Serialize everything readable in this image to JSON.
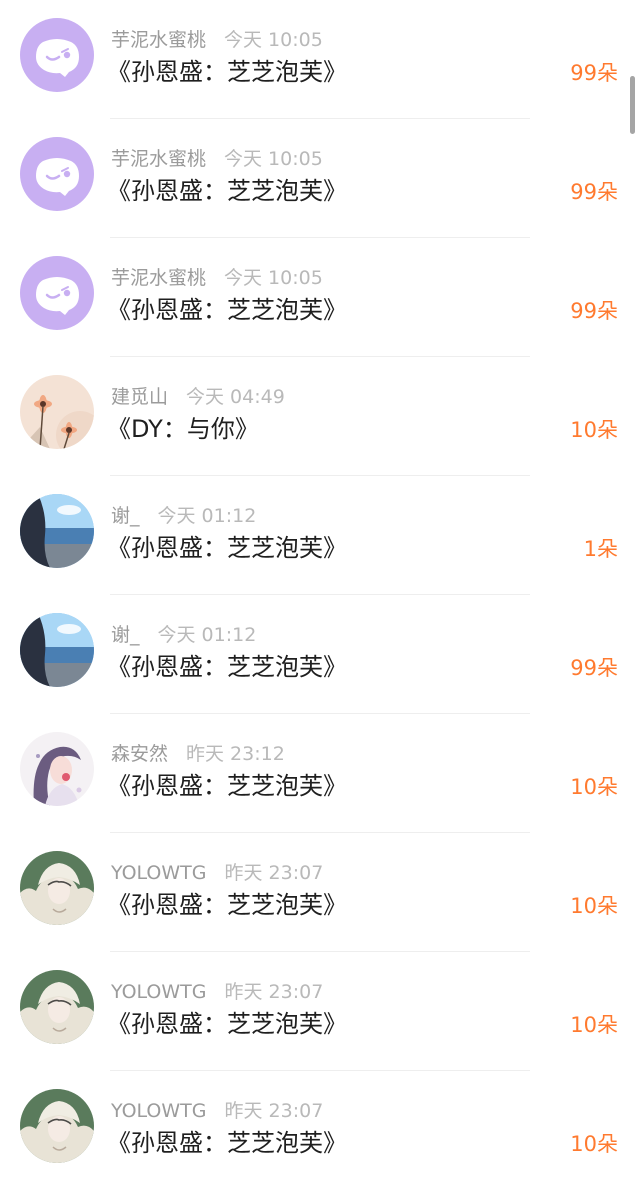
{
  "gift_list": {
    "items": [
      {
        "username": "芋泥水蜜桃",
        "time": "今天 10:05",
        "title": "《孙恩盛：芝芝泡芙》",
        "gift_count": "99朵",
        "avatar": "chat-bubble-avatar"
      },
      {
        "username": "芋泥水蜜桃",
        "time": "今天 10:05",
        "title": "《孙恩盛：芝芝泡芙》",
        "gift_count": "99朵",
        "avatar": "chat-bubble-avatar"
      },
      {
        "username": "芋泥水蜜桃",
        "time": "今天 10:05",
        "title": "《孙恩盛：芝芝泡芙》",
        "gift_count": "99朵",
        "avatar": "chat-bubble-avatar"
      },
      {
        "username": "建觅山",
        "time": "今天 04:49",
        "title": "《DY：与你》",
        "gift_count": "10朵",
        "avatar": "flower-photo-avatar"
      },
      {
        "username": "谢_",
        "time": "今天 01:12",
        "title": "《孙恩盛：芝芝泡芙》",
        "gift_count": "1朵",
        "avatar": "beach-photo-avatar"
      },
      {
        "username": "谢_",
        "time": "今天 01:12",
        "title": "《孙恩盛：芝芝泡芙》",
        "gift_count": "99朵",
        "avatar": "beach-photo-avatar"
      },
      {
        "username": "森安然",
        "time": "昨天 23:12",
        "title": "《孙恩盛：芝芝泡芙》",
        "gift_count": "10朵",
        "avatar": "illustrated-girl-avatar"
      },
      {
        "username": "YOLOWTG",
        "time": "昨天 23:07",
        "title": "《孙恩盛：芝芝泡芙》",
        "gift_count": "10朵",
        "avatar": "sketch-portrait-avatar"
      },
      {
        "username": "YOLOWTG",
        "time": "昨天 23:07",
        "title": "《孙恩盛：芝芝泡芙》",
        "gift_count": "10朵",
        "avatar": "sketch-portrait-avatar"
      },
      {
        "username": "YOLOWTG",
        "time": "昨天 23:07",
        "title": "《孙恩盛：芝芝泡芙》",
        "gift_count": "10朵",
        "avatar": "sketch-portrait-avatar"
      }
    ]
  },
  "colors": {
    "gift_count": "#ff7a2f",
    "username": "#9b9b9b",
    "timestamp": "#b9b9b9",
    "title": "#1f1f1f",
    "chat_avatar_bg": "#c8aff2",
    "divider": "#eeeeee"
  }
}
